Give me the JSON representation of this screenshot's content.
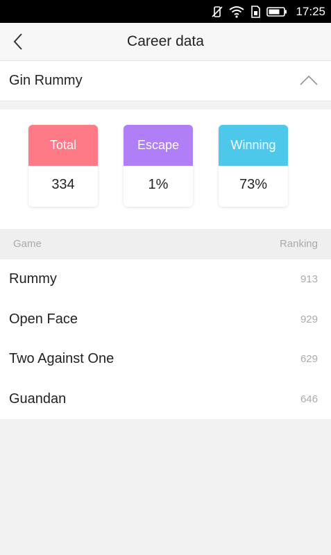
{
  "status_bar": {
    "time": "17:25"
  },
  "header": {
    "title": "Career data"
  },
  "game_selector": {
    "selected": "Gin Rummy"
  },
  "stats": [
    {
      "label": "Total",
      "value": "334",
      "color": "#fe7a86"
    },
    {
      "label": "Escape",
      "value": "1%",
      "color": "#b07ef7"
    },
    {
      "label": "Winning",
      "value": "73%",
      "color": "#4dc8ea"
    }
  ],
  "table": {
    "headers": {
      "game": "Game",
      "ranking": "Ranking"
    },
    "rows": [
      {
        "game": "Rummy",
        "ranking": "913"
      },
      {
        "game": "Open Face",
        "ranking": "929"
      },
      {
        "game": "Two Against One",
        "ranking": "629"
      },
      {
        "game": "Guandan",
        "ranking": "646"
      }
    ]
  }
}
